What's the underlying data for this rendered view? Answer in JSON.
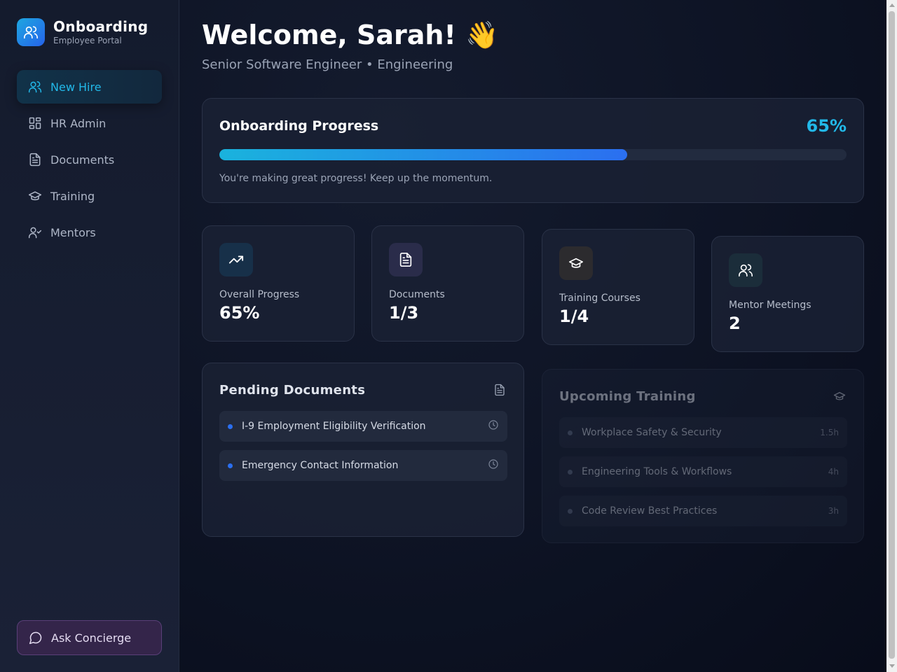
{
  "brand": {
    "title": "Onboarding",
    "subtitle": "Employee Portal"
  },
  "sidebar": {
    "items": [
      {
        "label": "New Hire",
        "icon": "users-icon",
        "active": true
      },
      {
        "label": "HR Admin",
        "icon": "grid-icon",
        "active": false
      },
      {
        "label": "Documents",
        "icon": "document-icon",
        "active": false
      },
      {
        "label": "Training",
        "icon": "graduation-cap-icon",
        "active": false
      },
      {
        "label": "Mentors",
        "icon": "user-check-icon",
        "active": false
      }
    ],
    "concierge_label": "Ask Concierge"
  },
  "header": {
    "welcome": "Welcome, Sarah! 👋",
    "role": "Senior Software Engineer • Engineering"
  },
  "progress": {
    "title": "Onboarding Progress",
    "percent_label": "65%",
    "percent": 65,
    "message": "You're making great progress! Keep up the momentum."
  },
  "stats": [
    {
      "label": "Overall Progress",
      "value": "65%",
      "icon": "trending-up-icon"
    },
    {
      "label": "Documents",
      "value": "1/3",
      "icon": "document-icon"
    },
    {
      "label": "Training Courses",
      "value": "1/4",
      "icon": "graduation-cap-icon"
    },
    {
      "label": "Mentor Meetings",
      "value": "2",
      "icon": "users-icon"
    }
  ],
  "pending_documents": {
    "title": "Pending Documents",
    "items": [
      {
        "label": "I-9 Employment Eligibility Verification"
      },
      {
        "label": "Emergency Contact Information"
      }
    ]
  },
  "upcoming_training": {
    "title": "Upcoming Training",
    "items": [
      {
        "label": "Workplace Safety & Security",
        "duration": "1.5h"
      },
      {
        "label": "Engineering Tools & Workflows",
        "duration": "4h"
      },
      {
        "label": "Code Review Best Practices",
        "duration": "3h"
      }
    ]
  },
  "colors": {
    "accent": "#22b8e8",
    "accent_blue": "#2b6ff0",
    "concierge": "#34254a"
  }
}
